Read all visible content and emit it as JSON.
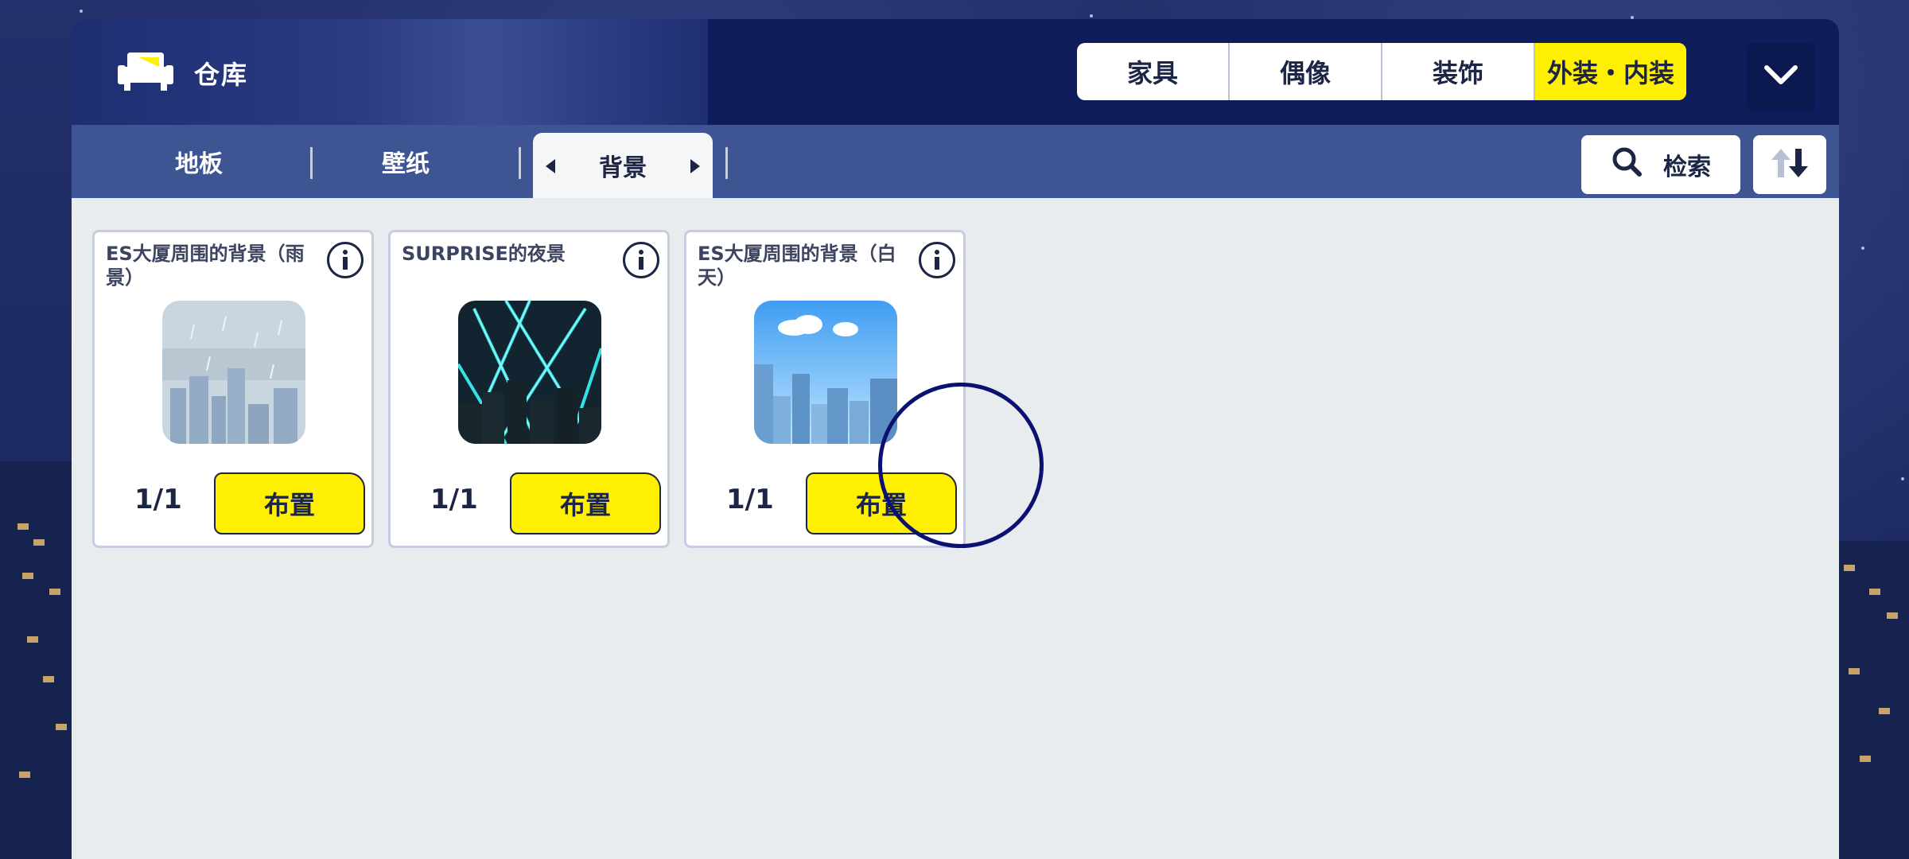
{
  "header": {
    "title": "仓库",
    "categories": [
      "家具",
      "偶像",
      "装饰",
      "外装・内装"
    ],
    "active_category_index": 3,
    "colors": {
      "header_bg": "#0f1d5c",
      "active_tab": "#ffef00",
      "sub_bar": "#3f5593",
      "panel": "#e8ecef"
    }
  },
  "subtabs": {
    "items": [
      "地板",
      "壁纸",
      "背景"
    ],
    "active_index": 2,
    "search_label": "检索"
  },
  "items": [
    {
      "name": "ES大厦周围的背景（雨景）",
      "quantity": "1/1",
      "button": "布置",
      "thumb": "rain-city"
    },
    {
      "name": "SURPRISE的夜景",
      "quantity": "1/1",
      "button": "布置",
      "thumb": "night-spotlights"
    },
    {
      "name": "ES大厦周围的背景（白天）",
      "quantity": "1/1",
      "button": "布置",
      "thumb": "day-city"
    }
  ]
}
